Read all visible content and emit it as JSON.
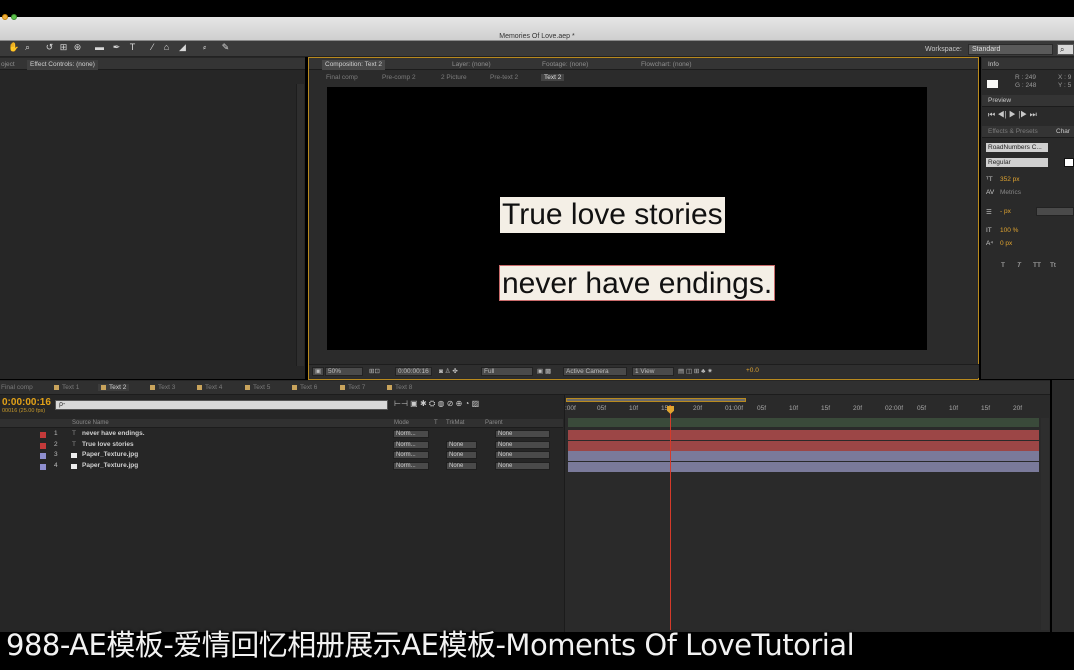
{
  "window": {
    "title": "Memories Of Love.aep *"
  },
  "toolbar": {
    "workspace_label": "Workspace:",
    "workspace_value": "Standard",
    "tools": [
      "hand-tool-icon",
      "zoom-tool-icon",
      "rotate-tool-icon",
      "camera-tool-icon",
      "pan-behind-icon",
      "rectangle-tool-icon",
      "pen-tool-icon",
      "type-tool-icon",
      "brush-tool-icon",
      "clone-stamp-icon",
      "eraser-icon",
      "roto-brush-icon",
      "puppet-pin-icon"
    ]
  },
  "left_panel": {
    "project_tab": "oject",
    "effect_controls_tab": "Effect Controls: (none)"
  },
  "viewer": {
    "tabs": [
      {
        "label": "Composition: Text 2",
        "active": true
      },
      {
        "label": "Layer: (none)",
        "active": false
      },
      {
        "label": "Footage: (none)",
        "active": false
      },
      {
        "label": "Flowchart: (none)",
        "active": false
      }
    ],
    "breadcrumbs": [
      "Final comp",
      "Pre-comp 2",
      "2 Picture",
      "Pre-text 2",
      "Text 2"
    ],
    "text_line_1": "True love stories",
    "text_line_2": "never have endings.",
    "zoom": "50%",
    "timecode": "0:00:00:16",
    "resolution": "Full",
    "camera": "Active Camera",
    "view": "1 View",
    "exposure": "+0.0"
  },
  "info_panel": {
    "tab": "Info",
    "r": "R : 249",
    "g": "G : 248",
    "x": "X : 9",
    "y": "Y : 5"
  },
  "preview_panel": {
    "tab": "Preview"
  },
  "effects_tab": "Effects & Presets",
  "character_panel": {
    "tab": "Char",
    "font": "RoadNumbers C...",
    "style": "Regular",
    "size": "352 px",
    "kerning": "Metrics",
    "leading_unit": "- px",
    "vertical_scale": "100 %",
    "baseline_shift": "0 px",
    "style_buttons": [
      "T",
      "T",
      "TT",
      "Tt"
    ]
  },
  "timeline": {
    "tabs": [
      {
        "label": "Final comp",
        "active": false
      },
      {
        "label": "Text 1",
        "active": false
      },
      {
        "label": "Text 2",
        "active": true
      },
      {
        "label": "Text 3",
        "active": false
      },
      {
        "label": "Text 4",
        "active": false
      },
      {
        "label": "Text 5",
        "active": false
      },
      {
        "label": "Text 6",
        "active": false
      },
      {
        "label": "Text 7",
        "active": false
      },
      {
        "label": "Text 8",
        "active": false
      }
    ],
    "current_time": "0:00:00:16",
    "fps": "00016 (25.00 fps)",
    "search_placeholder": "ρ-",
    "column_headers": {
      "source_name": "Source Name",
      "mode": "Mode",
      "t": "T",
      "trkmat": "TrkMat",
      "parent": "Parent"
    },
    "ruler": [
      ":00f",
      "05f",
      "10f",
      "15f",
      "20f",
      "01:00f",
      "05f",
      "10f",
      "15f",
      "20f",
      "02:00f",
      "05f",
      "10f",
      "15f",
      "20f"
    ],
    "layers": [
      {
        "num": "1",
        "name": "never have endings.",
        "type": "T",
        "color": "#c43a3a",
        "mode": "Norm...",
        "trkmat": "",
        "parent": "None",
        "bar": "#9c4646"
      },
      {
        "num": "2",
        "name": "True love stories",
        "type": "T",
        "color": "#c43a3a",
        "mode": "Norm...",
        "trkmat": "None",
        "parent": "None",
        "bar": "#9c4646"
      },
      {
        "num": "3",
        "name": "Paper_Texture.jpg",
        "type": "img",
        "color": "#8f8fd0",
        "mode": "Norm...",
        "trkmat": "None",
        "parent": "None",
        "bar": "#7a7a9a"
      },
      {
        "num": "4",
        "name": "Paper_Texture.jpg",
        "type": "img",
        "color": "#8f8fd0",
        "mode": "Norm...",
        "trkmat": "None",
        "parent": "None",
        "bar": "#7a7a9a"
      }
    ]
  },
  "caption": "988-AE模板-爱情回忆相册展示AE模板-Moments Of LoveTutorial"
}
